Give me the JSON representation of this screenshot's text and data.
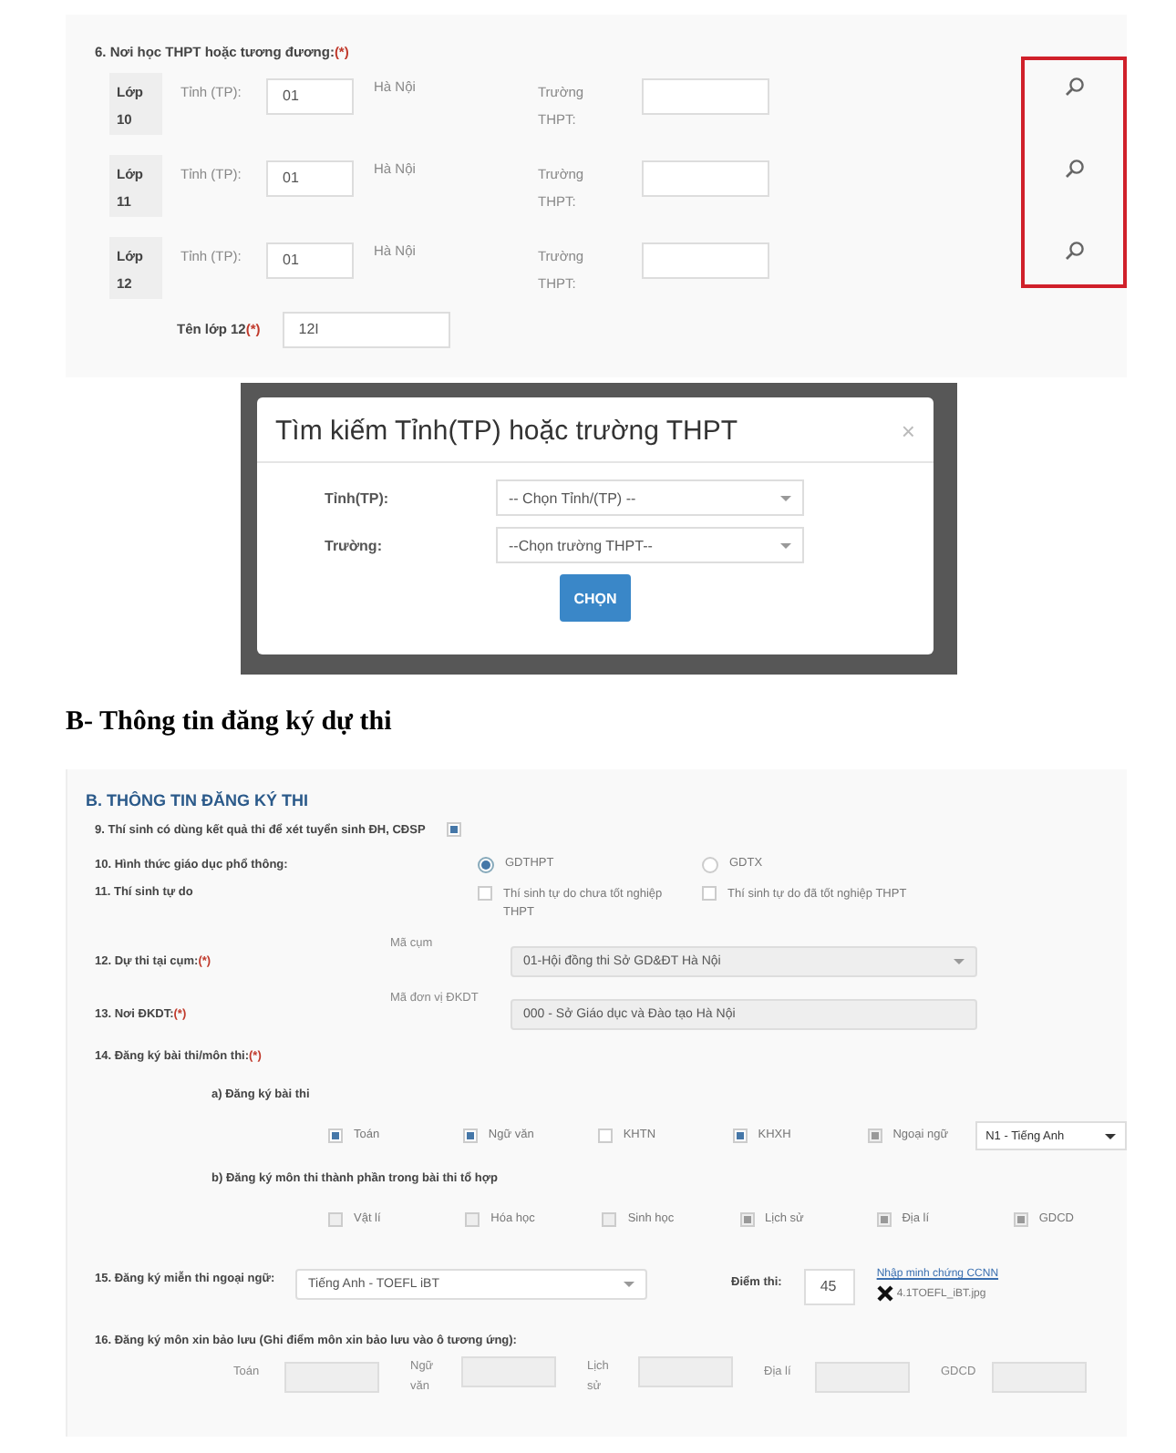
{
  "section_6": {
    "title": "6. Nơi học THPT hoặc tương đương:",
    "required_mark": "(*)",
    "rows": [
      {
        "grade_label": "Lớp",
        "grade": "10",
        "province_label": "Tỉnh (TP):",
        "province_code": "01",
        "province_name": "Hà Nội",
        "school_label": "Trường THPT:"
      },
      {
        "grade_label": "Lớp",
        "grade": "11",
        "province_label": "Tỉnh (TP):",
        "province_code": "01",
        "province_name": "Hà Nội",
        "school_label": "Trường THPT:"
      },
      {
        "grade_label": "Lớp",
        "grade": "12",
        "province_label": "Tỉnh (TP):",
        "province_code": "01",
        "province_name": "Hà Nội",
        "school_label": "Trường THPT:"
      }
    ],
    "class_label": "Tên lớp 12",
    "class_required_mark": "(*)",
    "class_value": "12I"
  },
  "modal": {
    "title": "Tìm kiếm Tỉnh(TP) hoặc trường THPT",
    "close": "×",
    "fields": [
      {
        "label": "Tỉnh(TP):",
        "value": "-- Chọn Tỉnh/(TP) --"
      },
      {
        "label": "Trường:",
        "value": "--Chọn trường THPT--"
      }
    ],
    "button": "CHỌN"
  },
  "heading": "B- Thông tin đăng ký dự thi",
  "section_b": {
    "title": "B. THÔNG TIN ĐĂNG KÝ THI",
    "q9": {
      "label": "9. Thí sinh có dùng kết quả thi để xét tuyển sinh ĐH, CĐSP",
      "checked": true
    },
    "q10": {
      "label": "10. Hình thức giáo dục phổ thông:",
      "options": [
        {
          "label": "GDTHPT",
          "selected": true
        },
        {
          "label": "GDTX",
          "selected": false
        }
      ]
    },
    "q11": {
      "label": "11. Thí sinh tự do",
      "options": [
        {
          "label": "Thí sinh tự do chưa tốt nghiệp THPT",
          "checked": false
        },
        {
          "label": "Thí sinh tự do đã tốt nghiệp THPT",
          "checked": false
        }
      ]
    },
    "q12": {
      "label": "12. Dự thi tại cụm:",
      "required_mark": "(*)",
      "sublabel": "Mã cụm",
      "value": "01-Hội đồng thi Sở GD&ĐT Hà Nội"
    },
    "q13": {
      "label": "13. Nơi ĐKDT:",
      "required_mark": "(*)",
      "sublabel": "Mã đơn vị ĐKDT",
      "value": "000 - Sở Giáo dục và Đào tạo Hà Nội"
    },
    "q14": {
      "label": "14. Đăng ký bài thi/môn thi:",
      "required_mark": "(*)",
      "a_label": "a) Đăng ký bài thi",
      "a_subjects": [
        {
          "label": "Toán",
          "checked": true,
          "disabled": false
        },
        {
          "label": "Ngữ văn",
          "checked": true,
          "disabled": false
        },
        {
          "label": "KHTN",
          "checked": false,
          "disabled": false
        },
        {
          "label": "KHXH",
          "checked": true,
          "disabled": false
        },
        {
          "label": "Ngoại ngữ",
          "checked": true,
          "disabled": true
        }
      ],
      "language": "N1 - Tiếng Anh",
      "b_label": "b) Đăng ký môn thi thành phần trong bài thi tổ hợp",
      "b_subjects": [
        {
          "label": "Vật lí",
          "checked": false,
          "disabled": true
        },
        {
          "label": "Hóa học",
          "checked": false,
          "disabled": true
        },
        {
          "label": "Sinh học",
          "checked": false,
          "disabled": true
        },
        {
          "label": "Lịch sử",
          "checked": true,
          "disabled": true
        },
        {
          "label": "Địa lí",
          "checked": true,
          "disabled": true
        },
        {
          "label": "GDCD",
          "checked": true,
          "disabled": true
        }
      ]
    },
    "q15": {
      "label": "15. Đăng ký miễn thi ngoại ngữ:",
      "value": "Tiếng Anh - TOEFL iBT",
      "score_label": "Điểm thi:",
      "score": "45",
      "link": "Nhập minh chứng CCNN",
      "file": "4.1TOEFL_iBT.jpg"
    },
    "q16": {
      "label": "16. Đăng ký môn xin bảo lưu (Ghi điểm môn xin bảo lưu vào ô tương ứng):",
      "fields": [
        {
          "label": "Toán"
        },
        {
          "label": "Ngữ văn"
        },
        {
          "label": "Lịch sử"
        },
        {
          "label": "Địa lí"
        },
        {
          "label": "GDCD"
        }
      ]
    }
  }
}
